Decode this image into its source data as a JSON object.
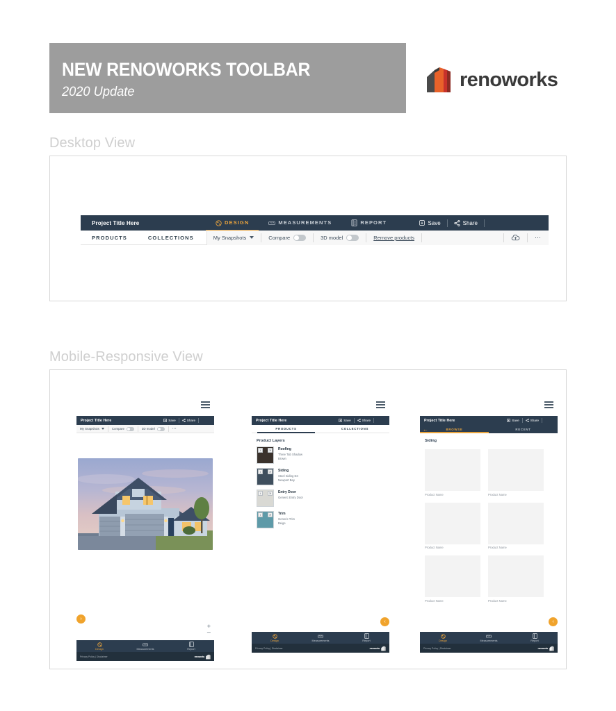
{
  "header": {
    "title": "NEW RENOWORKS TOOLBAR",
    "subtitle": "2020 Update",
    "band_color": "#9d9d9d"
  },
  "brand": {
    "wordmark": "renoworks",
    "mark_colors": [
      "#4a4a4a",
      "#e8622a",
      "#c8322b",
      "#8c2b22"
    ]
  },
  "sections": {
    "desktop_label": "Desktop View",
    "mobile_label": "Mobile-Responsive View"
  },
  "desktop_toolbar": {
    "project_title": "Project Title Here",
    "tabs": [
      {
        "label": "DESIGN",
        "icon": "palette-icon",
        "active": true
      },
      {
        "label": "MEASUREMENTS",
        "icon": "ruler-icon",
        "active": false
      },
      {
        "label": "REPORT",
        "icon": "report-icon",
        "active": false
      }
    ],
    "actions": [
      {
        "label": "Save",
        "icon": "save-icon"
      },
      {
        "label": "Share",
        "icon": "share-icon"
      }
    ],
    "subtabs": [
      {
        "label": "PRODUCTS",
        "active": true
      },
      {
        "label": "COLLECTIONS",
        "active": false
      }
    ],
    "controls": {
      "snapshots_label": "My Snapshots",
      "compare_label": "Compare",
      "compare_on": false,
      "model3d_label": "3D model",
      "model3d_on": false,
      "remove_products_label": "Remove products",
      "upload_icon": "cloud-upload-icon",
      "more_icon": "ellipsis-icon"
    },
    "accent_color": "#e8a33d",
    "bar_color": "#2c3d4f"
  },
  "phones": [
    {
      "id": "phone-design",
      "menu_icon": "hamburger-menu-icon",
      "project_title": "Project Title Here",
      "actions": [
        {
          "label": "Save",
          "icon": "save-icon"
        },
        {
          "label": "Share",
          "icon": "share-icon"
        }
      ],
      "controls": {
        "snapshots_label": "My Snapshots",
        "compare_label": "Compare",
        "model3d_label": "3D model",
        "more_icon": "ellipsis-icon"
      },
      "canvas": {
        "image_alt": "house-rendering",
        "left_arrow": "›",
        "zoom_in": "+",
        "zoom_out": "–"
      }
    },
    {
      "id": "phone-products",
      "menu_icon": "hamburger-menu-icon",
      "project_title": "Project Title Here",
      "actions": [
        {
          "label": "Save",
          "icon": "save-icon"
        },
        {
          "label": "Share",
          "icon": "share-icon"
        }
      ],
      "tabs": [
        {
          "label": "PRODUCTS",
          "active": true
        },
        {
          "label": "COLLECTIONS",
          "active": false
        }
      ],
      "section_title": "Product Layers",
      "layers": [
        {
          "name": "Roofing",
          "product": "Three Tab Shadow",
          "color": "Brown",
          "swatch": "#3a322c"
        },
        {
          "name": "Siding",
          "product": "Steel Siding D4",
          "color": "Newport Bay",
          "swatch": "#3f4f5e"
        },
        {
          "name": "Entry Door",
          "product": "Generic Entry Door",
          "color": "",
          "swatch": "#d9d9d4"
        },
        {
          "name": "Trim",
          "product": "Generic Trim",
          "color": "Beige",
          "swatch": "#5e9aa8"
        }
      ],
      "right_arrow": "‹"
    },
    {
      "id": "phone-browse",
      "menu_icon": "hamburger-menu-icon",
      "project_title": "Project Title Here",
      "back_icon": "back-arrow-icon",
      "actions": [
        {
          "label": "Save",
          "icon": "save-icon"
        },
        {
          "label": "Share",
          "icon": "share-icon"
        }
      ],
      "tabs": [
        {
          "label": "BROWSE",
          "active": true
        },
        {
          "label": "RECENT",
          "active": false
        }
      ],
      "section_title": "Siding",
      "product_caption": "Product Name",
      "product_count": 6,
      "right_arrow": "‹"
    }
  ],
  "bottom_nav": [
    {
      "label": "Design",
      "icon": "palette-icon",
      "active": true
    },
    {
      "label": "Measurements",
      "icon": "ruler-icon",
      "active": false
    },
    {
      "label": "Report",
      "icon": "report-icon",
      "active": false
    }
  ],
  "phone_footer": {
    "links": "Privacy Policy | Disclaimer",
    "brand": "renoworks"
  }
}
